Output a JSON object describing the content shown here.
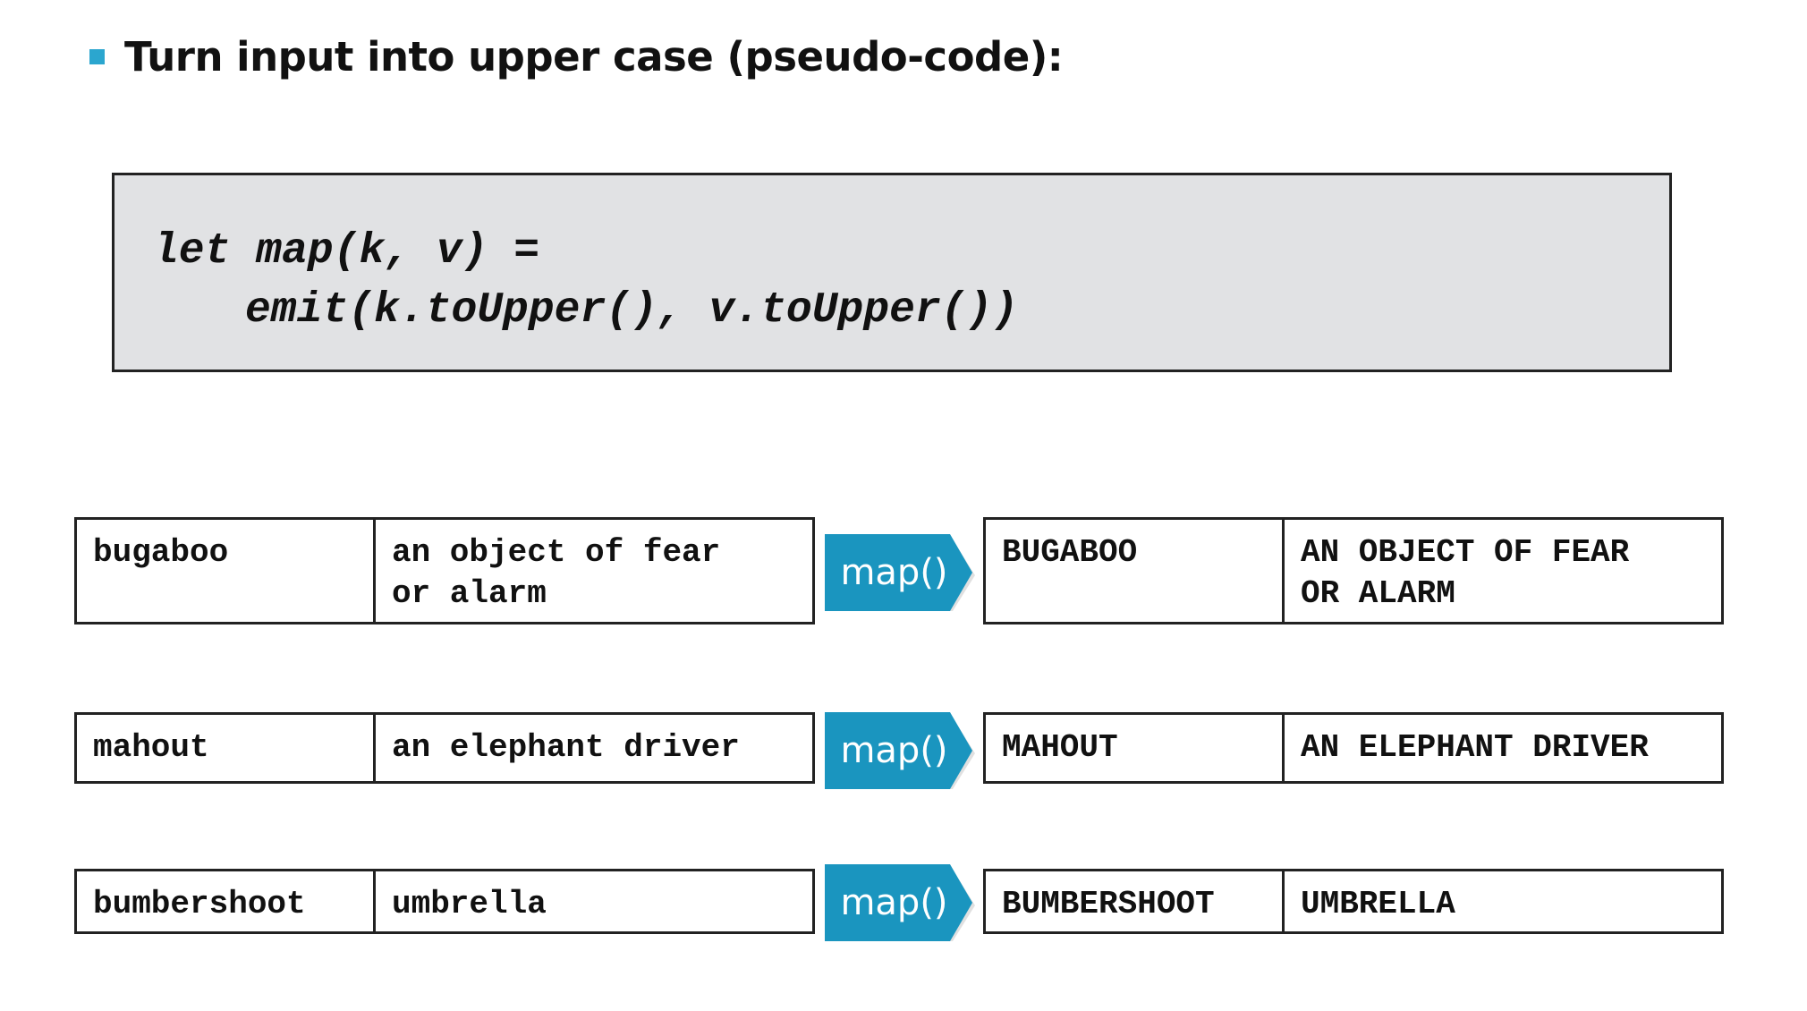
{
  "heading": {
    "text": "Turn input into upper case (pseudo-code):",
    "bullet_color": "#2ba6cf"
  },
  "code": {
    "line1": "let map(k, v) =",
    "line2": "emit(k.toUpper(), v.toUpper())"
  },
  "rows": [
    {
      "input_key": "bugaboo",
      "input_value": "an object of fear\nor alarm",
      "function_label": "map()",
      "output_key": "BUGABOO",
      "output_value": "AN OBJECT OF FEAR\nOR ALARM"
    },
    {
      "input_key": "mahout",
      "input_value": "an elephant driver",
      "function_label": "map()",
      "output_key": "MAHOUT",
      "output_value": "AN ELEPHANT DRIVER"
    },
    {
      "input_key": "bumbershoot",
      "input_value": "umbrella",
      "function_label": "map()",
      "output_key": "BUMBERSHOOT",
      "output_value": "UMBRELLA"
    }
  ],
  "colors": {
    "arrow_fill": "#1a95bf",
    "code_background": "#e1e2e4"
  }
}
